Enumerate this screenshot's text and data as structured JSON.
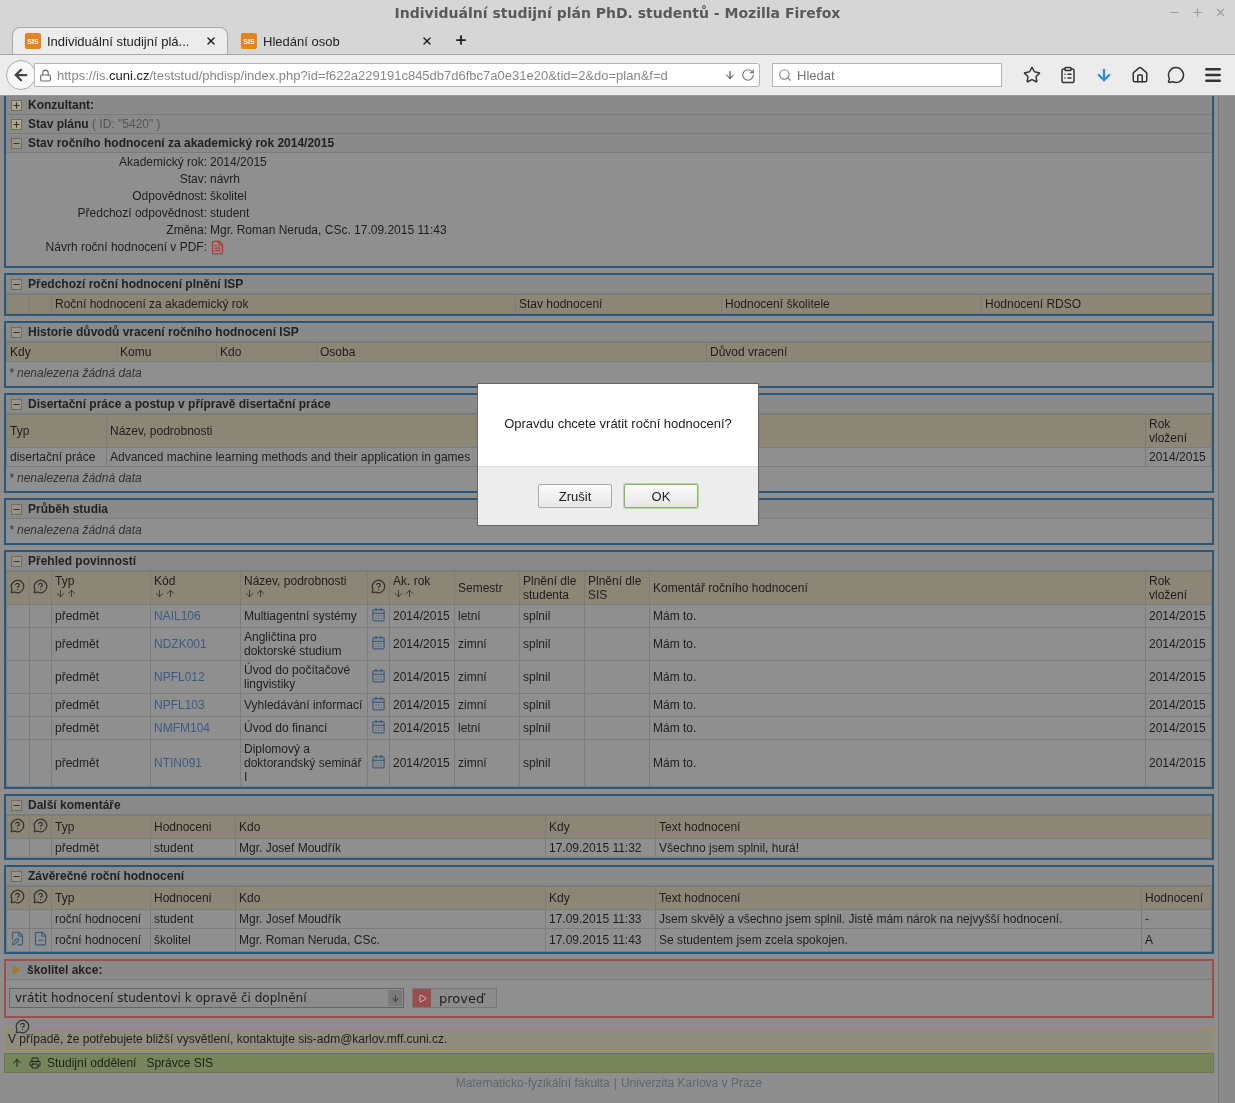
{
  "window": {
    "title": "Individuální studijní plán PhD. studentů - Mozilla Firefox"
  },
  "tabs": [
    {
      "label": "Individuální studijní plá...",
      "icon_text": "SIS",
      "selected": true
    },
    {
      "label": "Hledání osob",
      "icon_text": "SIS",
      "selected": false
    }
  ],
  "address": {
    "prefix": "https://is.",
    "domain": "cuni.cz",
    "path": "/teststud/phdisp/index.php?id=f622a229191c845db7d6fbc7a0e31e20&tid=2&do=plan&f=d"
  },
  "search": {
    "placeholder": "Hledat"
  },
  "plan_panel": {
    "headers": [
      {
        "title": "Konzultant:",
        "expanded": false
      },
      {
        "title": "Stav plánu",
        "note": "( ID: \"5420\" )",
        "expanded": false
      },
      {
        "title": "Stav ročního hodnocení za akademický rok 2014/2015",
        "expanded": true
      }
    ],
    "fields": [
      {
        "kind": "text",
        "label": "Akademický rok:",
        "value": "2014/2015"
      },
      {
        "kind": "text",
        "label": "Stav:",
        "value": "návrh"
      },
      {
        "kind": "text",
        "label": "Odpovědnost:",
        "value": "školitel"
      },
      {
        "kind": "text",
        "label": "Předchozí odpovědnost:",
        "value": "student"
      },
      {
        "kind": "text",
        "label": "Změna:",
        "value": "Mgr. Roman Neruda, CSc. 17.09.2015 11:43"
      },
      {
        "kind": "pdf",
        "label": "Návrh roční hodnocení v PDF:"
      }
    ]
  },
  "previous_evaluation": {
    "title": "Předchozí roční hodnocení plnění ISP",
    "expanded": true,
    "columns": [
      "Roční hodnocení za akademický rok",
      "Stav hodnocení",
      "Hodnocení školitele",
      "Hodnocení RDSO"
    ]
  },
  "return_history": {
    "title": "Historie důvodů vracení ročního hodnocení ISP",
    "expanded": true,
    "columns": [
      "Kdy",
      "Komu",
      "Kdo",
      "Osoba",
      "Důvod vracení"
    ],
    "empty_mark": "*",
    "empty_note": "nenalezena žádná data"
  },
  "thesis": {
    "title": "Disertační práce a postup v přípravě disertační práce",
    "expanded": true,
    "columns": [
      "Typ",
      "Název, podrobnosti",
      "Rok vložení"
    ],
    "rows": [
      [
        "disertační práce",
        "Advanced machine learning methods and their application in games",
        "2014/2015"
      ]
    ],
    "empty_mark": "*",
    "empty_note": "nenalezena žádná data"
  },
  "study_progress": {
    "title": "Průběh studia",
    "expanded": true,
    "empty_mark": "*",
    "empty_note": "nenalezena žádná data"
  },
  "duties": {
    "title": "Přehled povinností",
    "expanded": true,
    "columns": [
      {
        "kind": "help"
      },
      {
        "kind": "help"
      },
      {
        "kind": "text",
        "label": "Typ",
        "sortable": true
      },
      {
        "kind": "text",
        "label": "Kód",
        "sortable": true
      },
      {
        "kind": "text",
        "label": "Název, podrobnosti",
        "sortable": true
      },
      {
        "kind": "help"
      },
      {
        "kind": "text",
        "label": "Ak. rok",
        "sortable": true
      },
      {
        "kind": "text",
        "label": "Semestr",
        "sortable": false
      },
      {
        "kind": "text",
        "label": "Plnění dle studenta",
        "sortable": false
      },
      {
        "kind": "text",
        "label": "Plnění dle SIS",
        "sortable": false
      },
      {
        "kind": "text",
        "label": "Komentář ročního hodnocení",
        "sortable": false
      },
      {
        "kind": "text",
        "label": "Rok vložení",
        "sortable": false
      }
    ],
    "rows": [
      {
        "type": "předmět",
        "code": "NAIL106",
        "name": "Multiagentní systémy",
        "year": "2014/2015",
        "semester": "letní",
        "student": "splnil",
        "comment": "Mám to.",
        "inserted": "2014/2015"
      },
      {
        "type": "předmět",
        "code": "NDZK001",
        "name": "Angličtina pro doktorské studium",
        "year": "2014/2015",
        "semester": "zimní",
        "student": "splnil",
        "comment": "Mám to.",
        "inserted": "2014/2015"
      },
      {
        "type": "předmět",
        "code": "NPFL012",
        "name": "Úvod do počítačové lingvistiky",
        "year": "2014/2015",
        "semester": "zimní",
        "student": "splnil",
        "comment": "Mám to.",
        "inserted": "2014/2015"
      },
      {
        "type": "předmět",
        "code": "NPFL103",
        "name": "Vyhledávání informací",
        "year": "2014/2015",
        "semester": "zimní",
        "student": "splnil",
        "comment": "Mám to.",
        "inserted": "2014/2015"
      },
      {
        "type": "předmět",
        "code": "NMFM104",
        "name": "Úvod do financí",
        "year": "2014/2015",
        "semester": "letní",
        "student": "splnil",
        "comment": "Mám to.",
        "inserted": "2014/2015"
      },
      {
        "type": "předmět",
        "code": "NTIN091",
        "name": "Diplomový a doktorandský seminář I",
        "year": "2014/2015",
        "semester": "zimní",
        "student": "splnil",
        "comment": "Mám to.",
        "inserted": "2014/2015"
      }
    ]
  },
  "comments": {
    "title": "Další komentáře",
    "expanded": true,
    "columns": [
      "Typ",
      "Hodnoceni",
      "Kdo",
      "Kdy",
      "Text hodnocení"
    ],
    "rows": [
      {
        "icons": false,
        "cells": [
          "předmět",
          "student",
          "Mgr. Josef Moudřík",
          "17.09.2015 11:32",
          "Všechno jsem splnil, hurá!"
        ]
      }
    ]
  },
  "final_evaluation": {
    "title": "Závěrečné roční hodnocení",
    "expanded": true,
    "columns": [
      "Typ",
      "Hodnoceni",
      "Kdo",
      "Kdy",
      "Text hodnocení",
      "Hodnocení"
    ],
    "rows": [
      {
        "icons": false,
        "cells": [
          "roční hodnocení",
          "student",
          "Mgr. Josef Moudřík",
          "17.09.2015 11:33",
          "Jsem skvělý a všechno jsem splnil. Jistě mám nárok na nejvyšší hodnocení.",
          "-"
        ]
      },
      {
        "icons": true,
        "cells": [
          "roční hodnocení",
          "školitel",
          "Mgr. Roman Neruda, CSc.",
          "17.09.2015 11:43",
          "Se studentem jsem zcela spokojen.",
          "A"
        ]
      }
    ]
  },
  "actions": {
    "title": "školitel akce:",
    "select_value": "vrátit hodnocení studentovi k opravě či doplnění",
    "button": "proveď"
  },
  "help_note": "V případě, že potřebujete bližší vysvětlení, kontaktujte sis-adm@karlov.mff.cuni.cz.",
  "footer_bar": [
    "Studijní oddělení",
    "Správce SIS"
  ],
  "footer": {
    "links": [
      "Matematicko-fyzikální fakulta",
      "Univerzita Karlova v Praze"
    ],
    "separator": "|"
  },
  "dialog": {
    "message": "Opravdu chcete vrátit roční hodnocení?",
    "buttons": [
      {
        "label": "Zrušit",
        "default": false
      },
      {
        "label": "OK",
        "default": true
      }
    ]
  }
}
